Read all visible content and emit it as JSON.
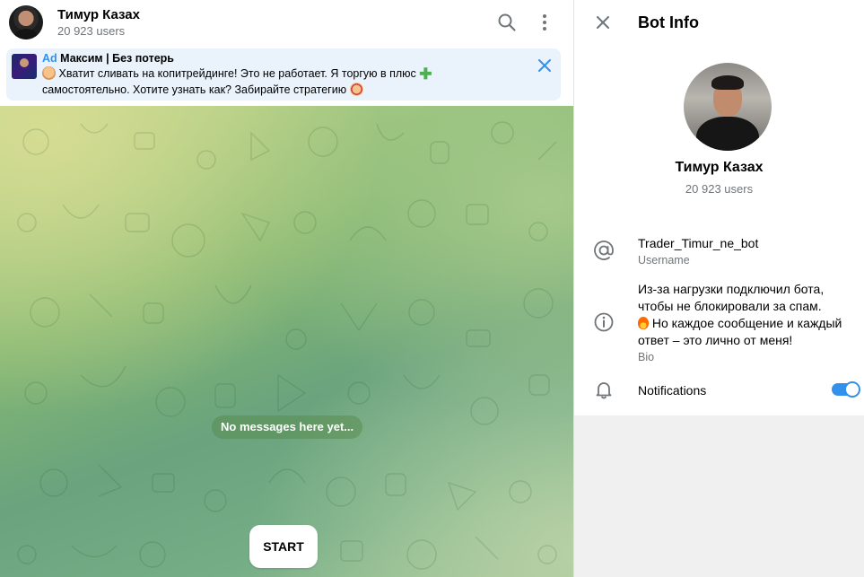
{
  "chat": {
    "title": "Тимур Казах",
    "subtitle": "20 923 users",
    "search_icon": "search-icon",
    "more_icon": "more-vertical-icon"
  },
  "ad": {
    "tag": "Ad",
    "sender": "Максим | Без потерь",
    "text_part1": "Хватит сливать на копитрейдинге! Это не работает. Я торгую в плюс",
    "text_part2": "самостоятельно. Хотите узнать как? Забирайте стратегию",
    "close_icon": "close-icon"
  },
  "messages": {
    "empty_text": "No messages here yet..."
  },
  "start_button": "START",
  "panel": {
    "title": "Bot Info",
    "name": "Тимур Казах",
    "subscribers": "20 923 users",
    "username_value": "Trader_Timur_ne_bot",
    "username_label": "Username",
    "bio_line1": "Из-за нагрузки подключил бота, чтобы не блокировали за спам.",
    "bio_line2": "Но каждое сообщение и каждый ответ – это лично от меня!",
    "bio_label": "Bio",
    "notifications_label": "Notifications",
    "notifications_enabled": true
  },
  "colors": {
    "accent": "#3390ec",
    "secondary_text": "#707579",
    "ad_background": "#eaf3fb"
  }
}
